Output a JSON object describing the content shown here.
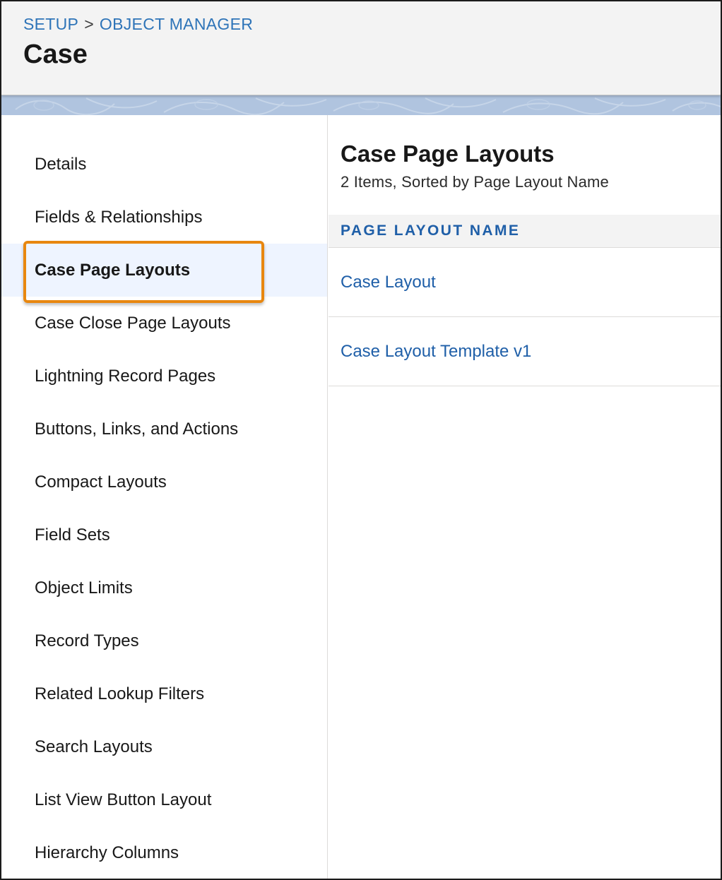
{
  "header": {
    "breadcrumb": [
      {
        "label": "SETUP"
      },
      {
        "label": "OBJECT MANAGER"
      }
    ],
    "breadcrumb_separator": ">",
    "title": "Case"
  },
  "sidebar": {
    "items": [
      {
        "label": "Details"
      },
      {
        "label": "Fields & Relationships"
      },
      {
        "label": "Case Page Layouts",
        "active": true
      },
      {
        "label": "Case Close Page Layouts"
      },
      {
        "label": "Lightning Record Pages"
      },
      {
        "label": "Buttons, Links, and Actions"
      },
      {
        "label": "Compact Layouts"
      },
      {
        "label": "Field Sets"
      },
      {
        "label": "Object Limits"
      },
      {
        "label": "Record Types"
      },
      {
        "label": "Related Lookup Filters"
      },
      {
        "label": "Search Layouts"
      },
      {
        "label": "List View Button Layout"
      },
      {
        "label": "Hierarchy Columns"
      }
    ]
  },
  "content": {
    "title": "Case Page Layouts",
    "subtitle": "2 Items, Sorted by Page Layout Name",
    "table": {
      "columns": [
        "PAGE LAYOUT NAME"
      ],
      "rows": [
        {
          "name": "Case Layout"
        },
        {
          "name": "Case Layout Template v1"
        }
      ]
    }
  },
  "colors": {
    "link": "#1f5fa8",
    "breadcrumb_link": "#2e74b8",
    "highlight": "#e8870f",
    "active_bg": "#eef4ff",
    "header_bg": "#f3f3f3",
    "band": "#b0c4df"
  }
}
